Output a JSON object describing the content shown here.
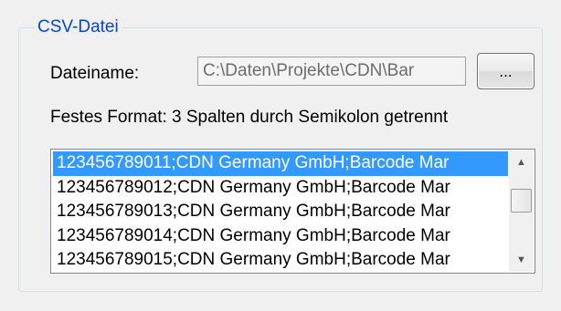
{
  "group": {
    "title": "CSV-Datei"
  },
  "file": {
    "label": "Dateiname:",
    "path": "C:\\Daten\\Projekte\\CDN\\Bar",
    "browse_label": "..."
  },
  "format_text": "Festes Format: 3 Spalten durch Semikolon getrennt",
  "list": {
    "items": [
      "123456789011;CDN Germany GmbH;Barcode Mar",
      "123456789012;CDN Germany GmbH;Barcode Mar",
      "123456789013;CDN Germany GmbH;Barcode Mar",
      "123456789014;CDN Germany GmbH;Barcode Mar",
      "123456789015;CDN Germany GmbH;Barcode Mar"
    ],
    "selected_index": 0
  },
  "icons": {
    "scroll_up": "scroll-up-arrow-icon",
    "scroll_down": "scroll-down-arrow-icon"
  },
  "colors": {
    "group_title": "#0046d5",
    "selection": "#3399ff",
    "disabled_text": "#6d6d6d"
  }
}
